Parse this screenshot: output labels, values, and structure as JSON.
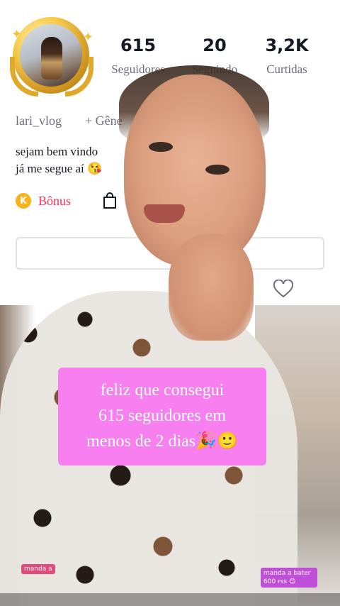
{
  "profile": {
    "username": "lari_vlog",
    "gender_button": "+ Gêne",
    "bio_line1": "sejam bem vindo",
    "bio_line2": "já me segue aí 😘",
    "bonus_label": "Bônus",
    "bonus_coin": "K",
    "stats": [
      {
        "value": "615",
        "label": "Seguidores"
      },
      {
        "value": "20",
        "label": "Seguindo"
      },
      {
        "value": "3,2K",
        "label": "Curtidas"
      }
    ]
  },
  "video": {
    "caption_line1": "feliz que consegui",
    "caption_line2": "615 seguidores em",
    "caption_line3": "menos de 2 dias🎉🙂",
    "corner_tag_left": "manda a",
    "corner_tag_right": "manda a bater 600 rss 😊"
  },
  "colors": {
    "accent_red": "#fe2c55",
    "caption_bg": "#f77ff0",
    "coin": "#f7b319"
  },
  "icons": [
    "bag-icon",
    "heart-icon",
    "crown-avatar-frame"
  ]
}
